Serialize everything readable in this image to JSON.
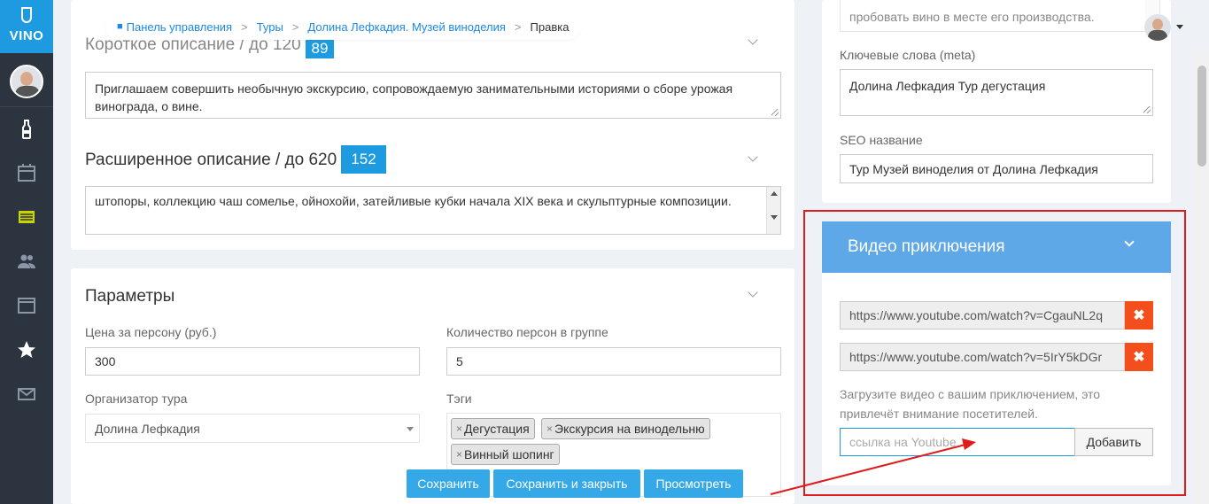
{
  "sidebar": {
    "logo_text": "VINO",
    "icons": [
      "wine-bottle-icon",
      "calendar-icon",
      "list-icon",
      "users-icon",
      "window-icon",
      "star-icon",
      "mail-icon"
    ]
  },
  "breadcrumb": {
    "items": [
      "Панель управления",
      "Туры",
      "Долина Лефкадия. Музей виноделия",
      "Правка"
    ]
  },
  "short_desc": {
    "heading": "Короткое описание / до 120",
    "count": "89",
    "text": "Приглашаем совершить необычную экскурсию, сопровождаемую занимательными историями о сборе урожая винограда, о вине."
  },
  "long_desc": {
    "heading": "Расширенное описание / до 620",
    "count": "152",
    "text": "штопоры, коллекцию чаш сомелье, ойнохойи, затейливые кубки начала XIX века и скульптурные композиции."
  },
  "params": {
    "heading": "Параметры",
    "price_label": "Цена за персону (руб.)",
    "price_value": "300",
    "group_label": "Количество персон в группе",
    "group_value": "5",
    "organizer_label": "Организатор тура",
    "organizer_value": "Долина Лефкадия",
    "tags_label": "Тэги",
    "tags": [
      "Дегустация",
      "Экскурсия на винодельню",
      "Винный шопинг"
    ]
  },
  "seo": {
    "top_text": "пробовать вино в месте его производства.",
    "keywords_label": "Ключевые слова (meta)",
    "keywords_value": "Долина Лефкадия Тур дегустация",
    "title_label": "SEO название",
    "title_value": "Тур Музей виноделия от Долина Лефкадия"
  },
  "video": {
    "heading": "Видео приключения",
    "urls": [
      "https://www.youtube.com/watch?v=CgauNL2q",
      "https://www.youtube.com/watch?v=5IrY5kDGr"
    ],
    "delete_label": "✖",
    "hint": "Загрузите видео с вашим приключением, это привлечёт внимание посетителей.",
    "input_placeholder": "ссылка на Youtube",
    "add_label": "Добавить"
  },
  "actions": {
    "save": "Сохранить",
    "save_close": "Сохранить и закрыть",
    "preview": "Просмотреть"
  },
  "colors": {
    "accent": "#1e9be0",
    "sidebar": "#2c3440",
    "video_header": "#5fa8e8",
    "delete": "#f34e1c",
    "highlight": "#e01b1b"
  }
}
